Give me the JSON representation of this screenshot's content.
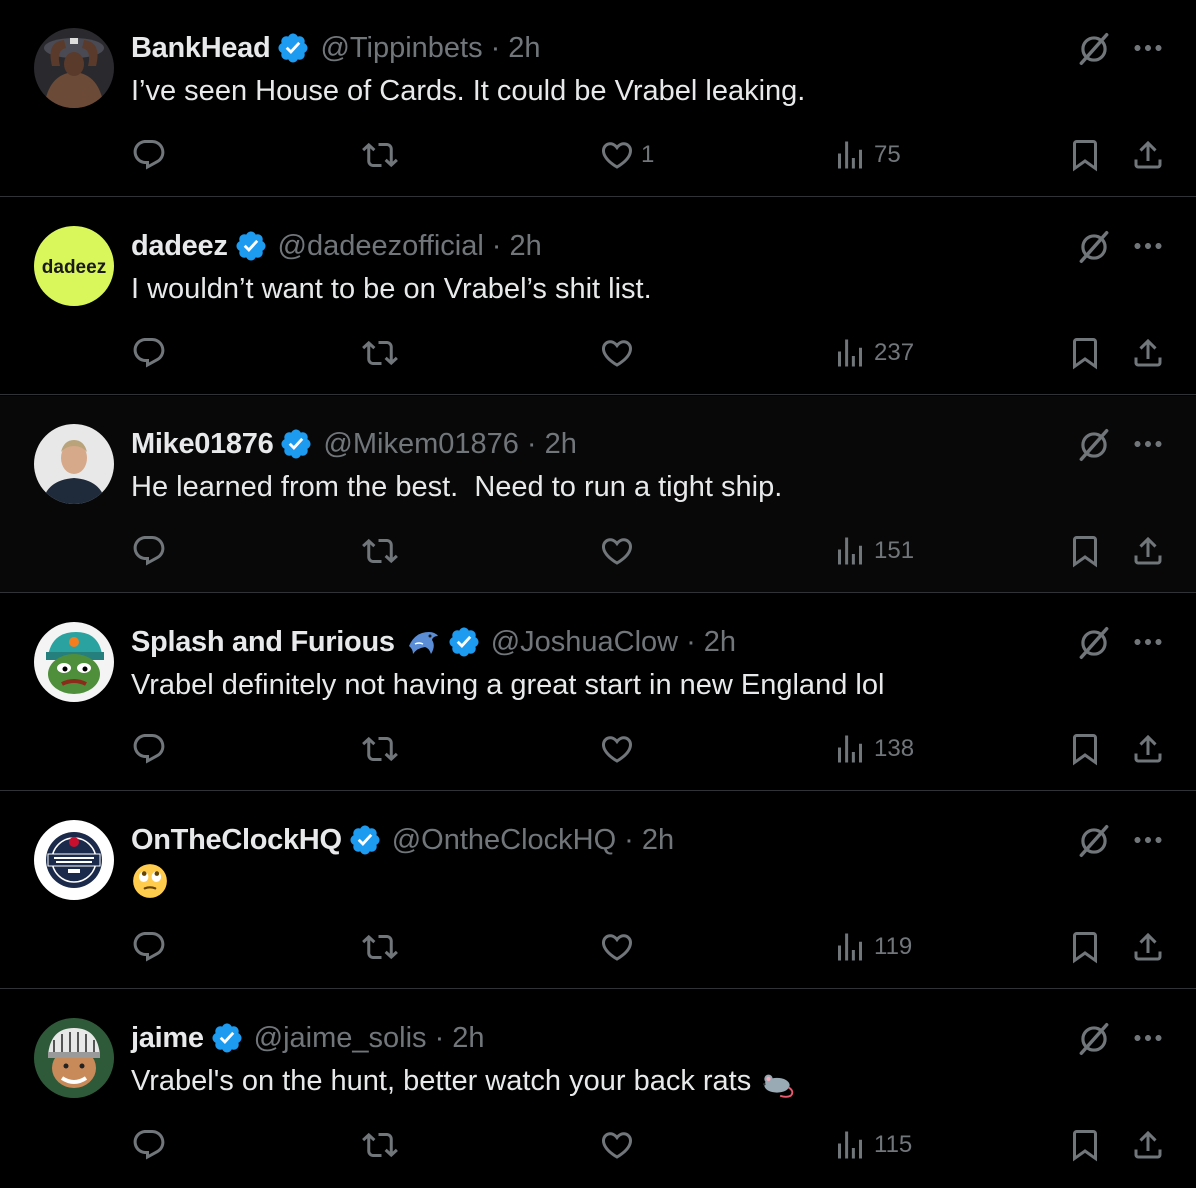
{
  "tweets": [
    {
      "name": "BankHead",
      "handle": "@Tippinbets",
      "separator": "·",
      "time": "2h",
      "text": "I’ve seen House of Cards. It could be Vrabel leaking.",
      "likes": "1",
      "views": "75",
      "avatar": "boxer-avatar"
    },
    {
      "name": "dadeez",
      "handle": "@dadeezofficial",
      "separator": "·",
      "time": "2h",
      "text": "I wouldn’t want to be on Vrabel’s shit list.",
      "likes": "",
      "views": "237",
      "avatar_text": "dadeez",
      "avatar_color": "#d9f75a"
    },
    {
      "name": "Mike01876",
      "handle": "@Mikem01876",
      "separator": "·",
      "time": "2h",
      "text": "He learned from the best.  Need to run a tight ship.",
      "likes": "",
      "views": "151",
      "avatar": "man-avatar"
    },
    {
      "name": "Splash and Furious",
      "name_emoji": "dolphin-emoji",
      "handle": "@JoshuaClow",
      "separator": "·",
      "time": "2h",
      "text": "Vrabel definitely not having a great start in new England lol",
      "likes": "",
      "views": "138",
      "avatar": "pepe-dolphins-avatar"
    },
    {
      "name": "OnTheClockHQ",
      "handle": "@OntheClockHQ",
      "separator": "·",
      "time": "2h",
      "text": "",
      "body_emoji": "face-with-rolling-eyes-emoji",
      "likes": "",
      "views": "119",
      "avatar": "on-the-clock-logo"
    },
    {
      "name": "jaime",
      "handle": "@jaime_solis",
      "separator": "·",
      "time": "2h",
      "text": "Vrabel's on the hunt, better watch your back rats",
      "body_emoji": "rat-emoji",
      "likes": "",
      "views": "115",
      "avatar": "helmet-cartoon-avatar"
    }
  ],
  "colors": {
    "background": "#000000",
    "hover_background": "#080808",
    "text": "#e7e9ea",
    "secondary": "#71767b",
    "verified": "#1d9bf0",
    "divider": "#2f3336"
  }
}
